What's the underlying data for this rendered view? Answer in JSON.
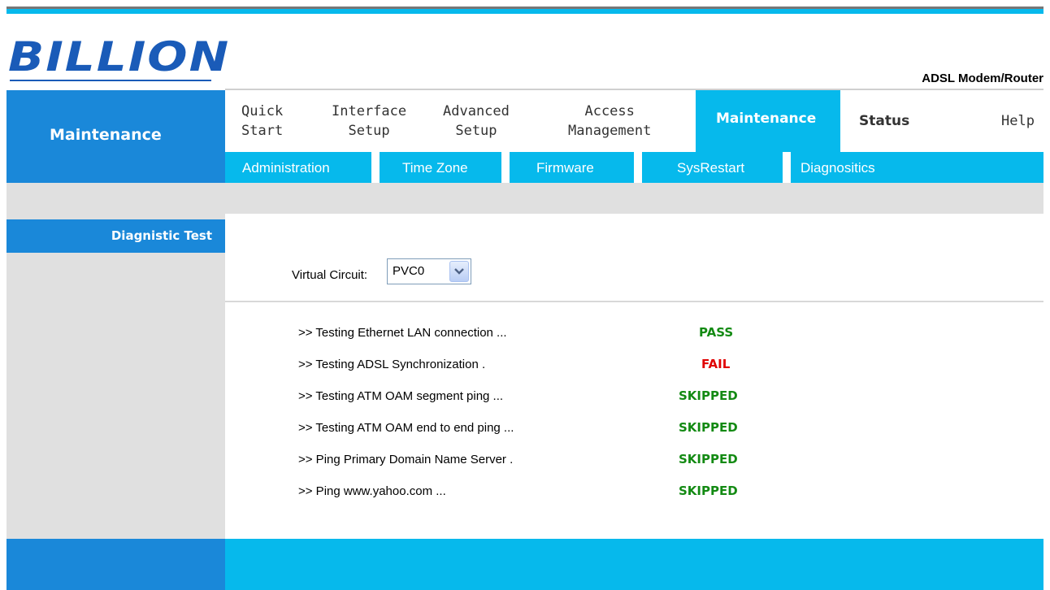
{
  "brand": {
    "logo_text": "BILLION",
    "product": "ADSL Modem/Router"
  },
  "section_title": "Maintenance",
  "nav": {
    "items": [
      {
        "line1": "Quick",
        "line2": "Start"
      },
      {
        "line1": "Interface",
        "line2": "Setup"
      },
      {
        "line1": "Advanced",
        "line2": "Setup"
      },
      {
        "line1": "Access",
        "line2": "Management"
      },
      {
        "label": "Maintenance",
        "active": true
      },
      {
        "label": "Status"
      },
      {
        "label": "Help"
      }
    ],
    "sub_items": [
      "Administration",
      "Time Zone",
      "Firmware",
      "SysRestart",
      "Diagnositics"
    ]
  },
  "sidebar": {
    "items": [
      "Diagnistic Test"
    ]
  },
  "form": {
    "virtual_circuit_label": "Virtual Circuit:",
    "virtual_circuit_value": "PVC0"
  },
  "tests": [
    {
      "label": ">> Testing Ethernet LAN connection ...",
      "result": "PASS",
      "color": "#138a13"
    },
    {
      "label": ">> Testing ADSL Synchronization .",
      "result": "FAIL",
      "color": "#e00000"
    },
    {
      "label": ">> Testing ATM OAM segment ping ...",
      "result": "SKIPPED",
      "color": "#138a13"
    },
    {
      "label": ">> Testing ATM OAM end to end ping ...",
      "result": "SKIPPED",
      "color": "#138a13"
    },
    {
      "label": ">> Ping Primary Domain Name Server .",
      "result": "SKIPPED",
      "color": "#138a13"
    },
    {
      "label": ">> Ping www.yahoo.com ...",
      "result": "SKIPPED",
      "color": "#138a13"
    }
  ],
  "colors": {
    "dark_blue": "#1a88d9",
    "light_blue": "#06b9ec",
    "gray": "#e0e0e0",
    "logo": "#1a5bb8"
  }
}
